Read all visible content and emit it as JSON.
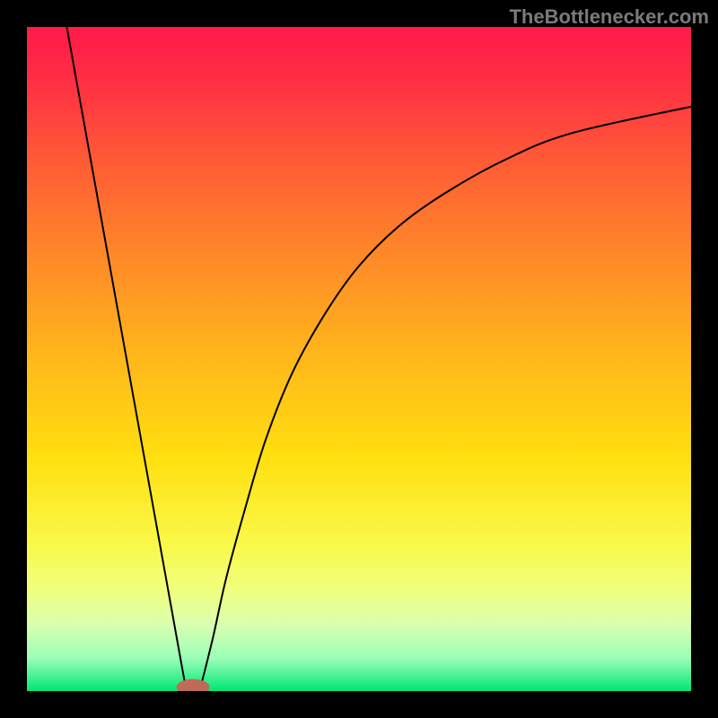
{
  "attribution": "TheBottlenecker.com",
  "chart_data": {
    "type": "line",
    "title": "",
    "xlabel": "",
    "ylabel": "",
    "xlim": [
      0,
      100
    ],
    "ylim": [
      0,
      100
    ],
    "gradient_stops": [
      {
        "offset": 0.0,
        "color": "#ff1a4a"
      },
      {
        "offset": 0.08,
        "color": "#ff2e44"
      },
      {
        "offset": 0.2,
        "color": "#ff5a36"
      },
      {
        "offset": 0.35,
        "color": "#ff8a28"
      },
      {
        "offset": 0.5,
        "color": "#ffb81a"
      },
      {
        "offset": 0.65,
        "color": "#ffe010"
      },
      {
        "offset": 0.78,
        "color": "#f9f94a"
      },
      {
        "offset": 0.85,
        "color": "#f0ff80"
      },
      {
        "offset": 0.9,
        "color": "#d8ffb0"
      },
      {
        "offset": 0.95,
        "color": "#9cffb8"
      },
      {
        "offset": 1.0,
        "color": "#00e676"
      }
    ],
    "series": [
      {
        "name": "left-branch",
        "x": [
          6,
          24
        ],
        "y": [
          100,
          0
        ]
      },
      {
        "name": "right-branch",
        "x": [
          26,
          28,
          30,
          33,
          36,
          40,
          45,
          50,
          56,
          63,
          72,
          82,
          100
        ],
        "y": [
          0,
          8,
          17,
          28,
          38,
          48,
          57,
          64,
          70,
          75,
          80,
          84,
          88
        ]
      }
    ],
    "marker": {
      "shape": "ellipse",
      "cx": 25,
      "cy": 0,
      "rx": 2.5,
      "ry": 1.2,
      "fill": "#c06a5a"
    }
  }
}
